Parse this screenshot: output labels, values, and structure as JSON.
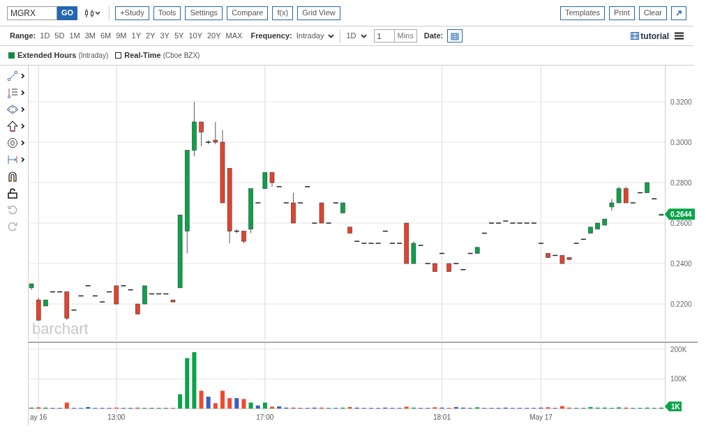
{
  "toolbar": {
    "symbol": "MGRX",
    "go": "GO",
    "buttons": [
      "+Study",
      "Tools",
      "Settings",
      "Compare",
      "f(x)",
      "Grid View"
    ],
    "right_buttons": [
      "Templates",
      "Print",
      "Clear"
    ]
  },
  "range": {
    "label": "Range:",
    "options": [
      "1D",
      "5D",
      "1M",
      "3M",
      "6M",
      "9M",
      "1Y",
      "2Y",
      "3Y",
      "5Y",
      "10Y",
      "20Y",
      "MAX"
    ]
  },
  "frequency": {
    "label": "Frequency:",
    "value": "Intraday",
    "interval": "1D",
    "count": "1",
    "unit": "Mins"
  },
  "date": {
    "label": "Date:"
  },
  "tutorial": "tutorial",
  "legend": [
    {
      "label": "Extended Hours",
      "note": "(Intraday)",
      "checked": true
    },
    {
      "label": "Real-Time",
      "note": "(Cboe BZX)",
      "checked": false
    }
  ],
  "price_chart": {
    "logo": "barchart",
    "last_price": "0.2644",
    "chart_data": {
      "type": "candlestick",
      "grid": true,
      "ylim": [
        0.2021,
        0.3379
      ],
      "yticks": [
        {
          "value": 0.22,
          "label": "0.2200"
        },
        {
          "value": 0.24,
          "label": "0.2400"
        },
        {
          "value": 0.26,
          "label": "0.2600"
        },
        {
          "value": 0.28,
          "label": "0.2800"
        },
        {
          "value": 0.3,
          "label": "0.3000"
        },
        {
          "value": 0.32,
          "label": "0.3200"
        }
      ],
      "categories": [
        null,
        null,
        null,
        null,
        null,
        null,
        null,
        null,
        null,
        null,
        null,
        null,
        null,
        null,
        null,
        null,
        null,
        null,
        null,
        null,
        null,
        null,
        null,
        null,
        null,
        null,
        null,
        null,
        null,
        null,
        null,
        null,
        null,
        null,
        null,
        null,
        null,
        null,
        null,
        null,
        null,
        null,
        null,
        null,
        null,
        null,
        null,
        null,
        null,
        null,
        null,
        null,
        null,
        null,
        null,
        null,
        null,
        null,
        null,
        null,
        null,
        null,
        null,
        null,
        null,
        null,
        null,
        null,
        null,
        null,
        null,
        null,
        null,
        null,
        null,
        null,
        null,
        null,
        null,
        null,
        null,
        null,
        null,
        null,
        null,
        null,
        null,
        null,
        null,
        null
      ],
      "ohlc": [
        [
          0.228,
          0.23,
          0.227,
          0.23
        ],
        [
          0.222,
          0.223,
          0.212,
          0.212
        ],
        [
          0.219,
          0.222,
          0.219,
          0.222
        ],
        [
          0.226,
          0.226,
          0.226,
          0.226
        ],
        [
          0.226,
          0.226,
          0.226,
          0.226
        ],
        [
          0.226,
          0.226,
          0.212,
          0.213
        ],
        [
          0.217,
          0.217,
          0.217,
          0.217
        ],
        [
          0.224,
          0.224,
          0.224,
          0.224
        ],
        [
          0.229,
          0.229,
          0.229,
          0.229
        ],
        [
          0.224,
          0.224,
          0.224,
          0.224
        ],
        [
          0.221,
          0.221,
          0.221,
          0.221
        ],
        [
          0.226,
          0.226,
          0.226,
          0.226
        ],
        [
          0.229,
          0.229,
          0.22,
          0.22
        ],
        [
          0.229,
          0.229,
          0.229,
          0.229
        ],
        [
          0.227,
          0.227,
          0.227,
          0.227
        ],
        [
          0.22,
          0.22,
          0.215,
          0.215
        ],
        [
          0.22,
          0.229,
          0.22,
          0.229
        ],
        [
          0.225,
          0.225,
          0.225,
          0.225
        ],
        [
          0.225,
          0.225,
          0.225,
          0.225
        ],
        [
          0.225,
          0.225,
          0.225,
          0.225
        ],
        [
          0.222,
          0.222,
          0.221,
          0.221
        ],
        [
          0.228,
          0.264,
          0.228,
          0.264
        ],
        [
          0.256,
          0.296,
          0.245,
          0.296
        ],
        [
          0.296,
          0.32,
          0.293,
          0.31
        ],
        [
          0.31,
          0.31,
          0.298,
          0.305
        ],
        [
          0.3,
          0.301,
          0.299,
          0.3
        ],
        [
          0.301,
          0.31,
          0.299,
          0.3
        ],
        [
          0.3,
          0.306,
          0.27,
          0.27
        ],
        [
          0.287,
          0.287,
          0.25,
          0.256
        ],
        [
          0.256,
          0.257,
          0.255,
          0.256
        ],
        [
          0.256,
          0.256,
          0.25,
          0.251
        ],
        [
          0.257,
          0.277,
          0.255,
          0.277
        ],
        [
          0.27,
          0.27,
          0.27,
          0.27
        ],
        [
          0.277,
          0.285,
          0.277,
          0.285
        ],
        [
          0.285,
          0.285,
          0.278,
          0.28
        ],
        [
          0.278,
          0.278,
          0.278,
          0.278
        ],
        [
          0.27,
          0.27,
          0.27,
          0.27
        ],
        [
          0.27,
          0.275,
          0.26,
          0.26
        ],
        [
          0.27,
          0.27,
          0.27,
          0.27
        ],
        [
          0.278,
          0.278,
          0.278,
          0.278
        ],
        [
          0.26,
          0.26,
          0.26,
          0.26
        ],
        [
          0.27,
          0.27,
          0.26,
          0.26
        ],
        [
          0.26,
          0.26,
          0.26,
          0.26
        ],
        [
          0.27,
          0.27,
          0.27,
          0.27
        ],
        [
          0.265,
          0.27,
          0.265,
          0.27
        ],
        [
          0.258,
          0.258,
          0.255,
          0.255
        ],
        [
          0.251,
          0.251,
          0.251,
          0.251
        ],
        [
          0.25,
          0.25,
          0.25,
          0.25
        ],
        [
          0.25,
          0.25,
          0.25,
          0.25
        ],
        [
          0.25,
          0.25,
          0.25,
          0.25
        ],
        [
          0.256,
          0.256,
          0.256,
          0.256
        ],
        [
          0.25,
          0.25,
          0.25,
          0.25
        ],
        [
          0.25,
          0.25,
          0.25,
          0.25
        ],
        [
          0.26,
          0.26,
          0.24,
          0.24
        ],
        [
          0.24,
          0.251,
          0.24,
          0.25
        ],
        [
          0.249,
          0.249,
          0.249,
          0.249
        ],
        [
          0.24,
          0.24,
          0.24,
          0.24
        ],
        [
          0.24,
          0.24,
          0.236,
          0.236
        ],
        [
          0.245,
          0.245,
          0.245,
          0.245
        ],
        [
          0.24,
          0.24,
          0.236,
          0.236
        ],
        [
          0.24,
          0.24,
          0.24,
          0.24
        ],
        [
          0.237,
          0.237,
          0.237,
          0.237
        ],
        [
          0.245,
          0.245,
          0.245,
          0.245
        ],
        [
          0.245,
          0.248,
          0.245,
          0.248
        ],
        [
          0.255,
          0.255,
          0.255,
          0.255
        ],
        [
          0.26,
          0.26,
          0.26,
          0.26
        ],
        [
          0.26,
          0.26,
          0.26,
          0.26
        ],
        [
          0.261,
          0.261,
          0.261,
          0.261
        ],
        [
          0.26,
          0.26,
          0.26,
          0.26
        ],
        [
          0.26,
          0.26,
          0.26,
          0.26
        ],
        [
          0.26,
          0.26,
          0.26,
          0.26
        ],
        [
          0.26,
          0.26,
          0.26,
          0.26
        ],
        [
          0.25,
          0.25,
          0.25,
          0.25
        ],
        [
          0.245,
          0.245,
          0.243,
          0.243
        ],
        [
          0.244,
          0.244,
          0.244,
          0.244
        ],
        [
          0.244,
          0.244,
          0.24,
          0.24
        ],
        [
          0.243,
          0.243,
          0.242,
          0.242
        ],
        [
          0.25,
          0.25,
          0.25,
          0.25
        ],
        [
          0.252,
          0.252,
          0.252,
          0.252
        ],
        [
          0.255,
          0.258,
          0.255,
          0.258
        ],
        [
          0.257,
          0.26,
          0.257,
          0.26
        ],
        [
          0.259,
          0.262,
          0.259,
          0.262
        ],
        [
          0.268,
          0.272,
          0.266,
          0.27
        ],
        [
          0.27,
          0.278,
          0.27,
          0.277
        ],
        [
          0.277,
          0.278,
          0.27,
          0.27
        ],
        [
          0.27,
          0.27,
          0.27,
          0.27
        ],
        [
          0.275,
          0.275,
          0.275,
          0.275
        ],
        [
          0.275,
          0.28,
          0.275,
          0.28
        ],
        [
          0.272,
          0.272,
          0.272,
          0.272
        ],
        [
          0.2638,
          0.2646,
          0.2638,
          0.2644
        ]
      ]
    }
  },
  "volume_chart": {
    "last_volume": "1K",
    "chart_data": {
      "type": "bar",
      "grid": true,
      "ylim": [
        0,
        221000
      ],
      "yticks": [
        {
          "value": 100000,
          "label": "100K"
        },
        {
          "value": 200000,
          "label": "200K"
        }
      ],
      "categories": [
        null,
        "ay 16",
        null,
        null,
        null,
        null,
        null,
        null,
        null,
        null,
        null,
        null,
        "13:00",
        null,
        null,
        null,
        null,
        null,
        null,
        null,
        null,
        null,
        null,
        null,
        null,
        null,
        null,
        null,
        null,
        null,
        null,
        null,
        null,
        "17:00",
        null,
        null,
        null,
        null,
        null,
        null,
        null,
        null,
        null,
        null,
        null,
        null,
        null,
        null,
        null,
        null,
        null,
        null,
        null,
        null,
        null,
        null,
        null,
        null,
        "18:01",
        null,
        null,
        null,
        null,
        null,
        null,
        null,
        null,
        null,
        null,
        null,
        null,
        null,
        "May 17",
        null,
        null,
        null,
        null,
        null,
        null,
        null,
        null,
        null,
        null,
        null,
        null,
        null,
        null,
        null,
        null,
        null
      ],
      "values": [
        3000,
        4000,
        3000,
        2000,
        2000,
        20000,
        2000,
        2000,
        5000,
        2000,
        2000,
        2000,
        3000,
        2000,
        2000,
        3000,
        2000,
        2000,
        2000,
        2000,
        2000,
        48000,
        170000,
        190000,
        60000,
        40000,
        18000,
        60000,
        35000,
        35000,
        32000,
        20000,
        10000,
        20000,
        6000,
        7000,
        3000,
        3000,
        2000,
        2000,
        3000,
        3000,
        2000,
        2000,
        3000,
        5000,
        3000,
        2000,
        2000,
        2000,
        3000,
        2000,
        2000,
        6000,
        3000,
        2000,
        2000,
        4000,
        3000,
        2000,
        5000,
        3000,
        2000,
        4000,
        2000,
        2000,
        2000,
        3000,
        2000,
        2000,
        2000,
        2000,
        3000,
        4000,
        2000,
        8000,
        3000,
        2000,
        2000,
        5000,
        3000,
        3000,
        2000,
        4000,
        3000,
        2000,
        2000,
        3000,
        2000,
        3000
      ]
    }
  }
}
